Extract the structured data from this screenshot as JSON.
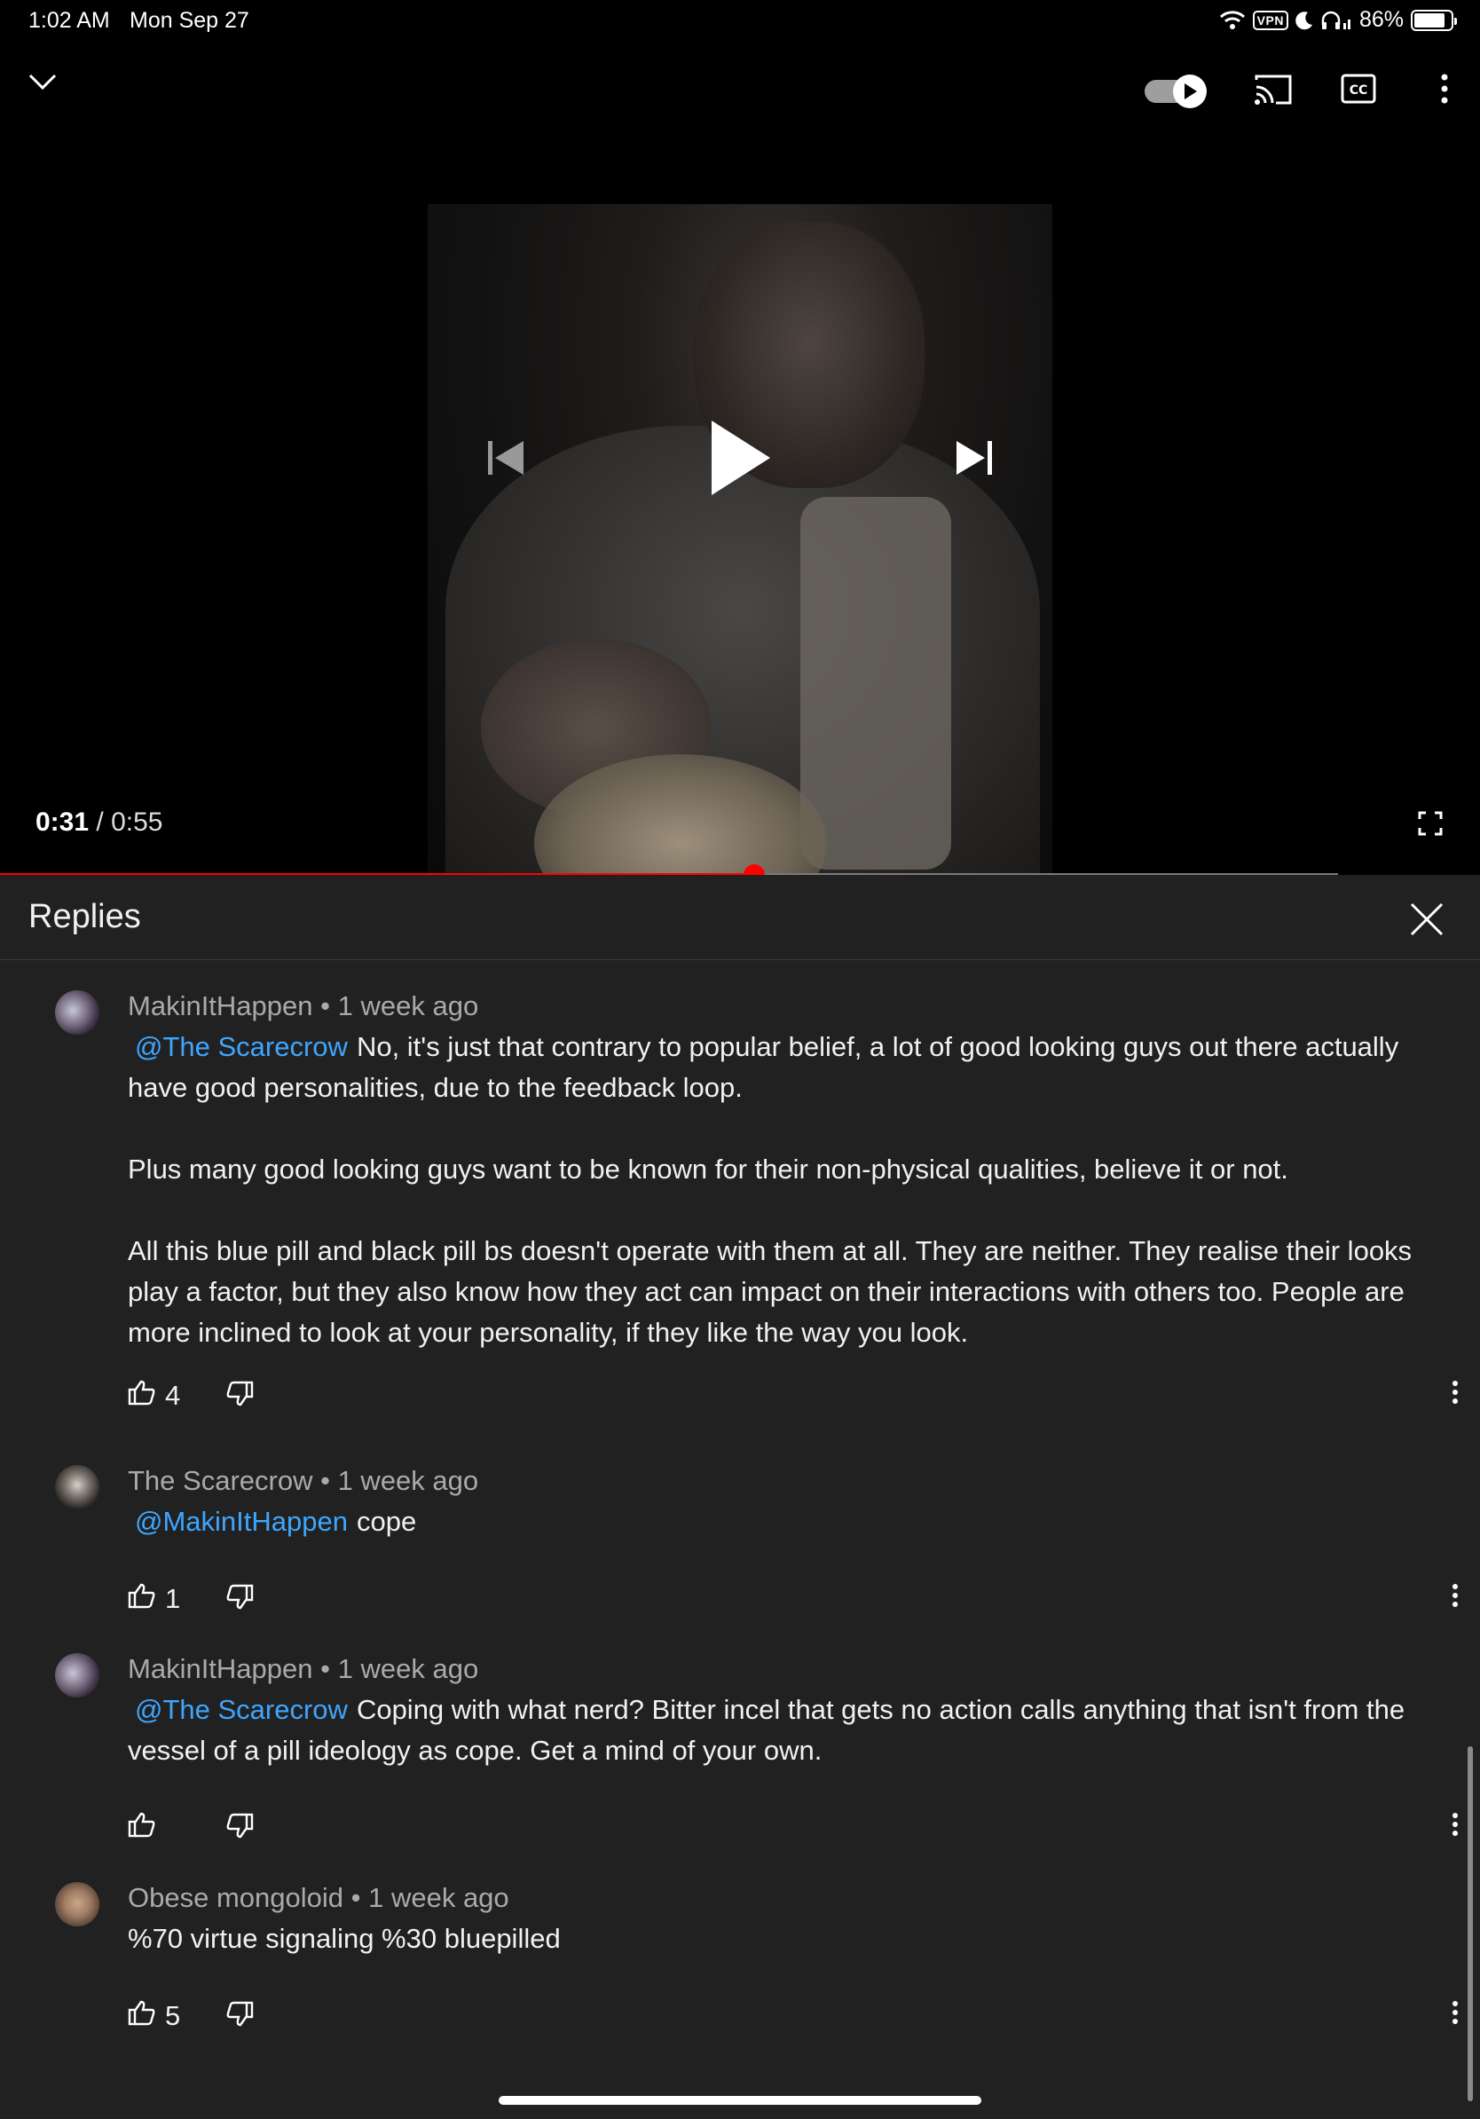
{
  "status_bar": {
    "time": "1:02 AM",
    "date": "Mon Sep 27",
    "vpn": "VPN",
    "battery": "86%",
    "battery_level": 0.86,
    "icons": [
      "wifi-icon",
      "vpn-badge",
      "moon-icon",
      "headphones-icon",
      "battery-icon"
    ]
  },
  "player": {
    "current_time": "0:31",
    "separator": "/",
    "duration": "0:55",
    "progress_fraction": 0.5636,
    "icons": {
      "minimize": "chevron-down-icon",
      "autoplay": "autoplay-toggle",
      "cast": "cast-icon",
      "captions": "cc-icon",
      "more": "more-vertical-icon",
      "previous": "skip-previous-icon",
      "play": "play-icon",
      "next": "skip-next-icon",
      "fullscreen": "fullscreen-icon"
    },
    "colors": {
      "progress": "#ff0000",
      "track": "#7a7a7a"
    }
  },
  "replies": {
    "title": "Replies",
    "close_icon": "close-icon",
    "colors": {
      "mention": "#3ea6ff",
      "meta": "#aaaaaa",
      "text": "#f1f1f1",
      "panel": "#212121"
    },
    "comments": [
      {
        "author": "MakinItHappen",
        "dot": "•",
        "age": "1 week ago",
        "mention": "@The Scarecrow",
        "paragraphs": [
          "No, it's just that contrary to popular belief, a lot of good looking guys out there actually have good personalities, due to the feedback loop.",
          "Plus many good looking guys want to be known for their non-physical qualities, believe it or not.",
          "All this blue pill and black pill bs doesn't operate with them at all. They are neither. They realise their looks play a factor, but they also know how they act can impact on their interactions with others too. People are more inclined to look at your personality, if they like the way you look."
        ],
        "likes": "4"
      },
      {
        "author": "The Scarecrow",
        "dot": "•",
        "age": "1 week ago",
        "mention": "@MakinItHappen",
        "paragraphs": [
          "cope"
        ],
        "likes": "1"
      },
      {
        "author": "MakinItHappen",
        "dot": "•",
        "age": "1 week ago",
        "mention": "@The Scarecrow",
        "paragraphs": [
          "Coping with what nerd? Bitter incel that gets no action calls anything that isn't from the vessel of a pill ideology as cope. Get a mind of your own."
        ],
        "likes": ""
      },
      {
        "author": "Obese mongoloid",
        "dot": "•",
        "age": "1 week ago",
        "mention": "",
        "paragraphs": [
          "%70 virtue signaling %30 bluepilled"
        ],
        "likes": "5"
      }
    ]
  }
}
